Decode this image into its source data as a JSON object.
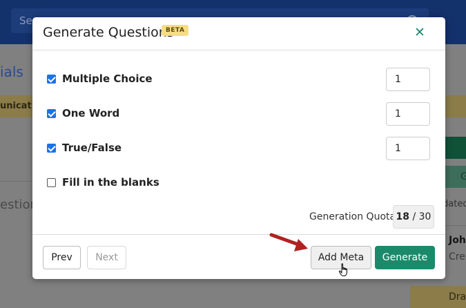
{
  "background": {
    "search_placeholder": "Sea",
    "heading_fragment": "ials",
    "badge_fragment": "unicat",
    "questions_fragment": "estion",
    "green_btn_fragment": "G",
    "updated_fragment": "dated",
    "card_name_fragment": "John",
    "card_sub_fragment": "Crea",
    "draft_fragment": "Dra"
  },
  "modal": {
    "title": "Generate Questions",
    "beta_label": "BETA",
    "options": [
      {
        "label": "Multiple Choice",
        "checked": true,
        "count": "1"
      },
      {
        "label": "One Word",
        "checked": true,
        "count": "1"
      },
      {
        "label": "True/False",
        "checked": true,
        "count": "1"
      },
      {
        "label": "Fill in the blanks",
        "checked": false
      }
    ],
    "quota": {
      "label": "Generation Quota",
      "used": "18",
      "separator": "/",
      "total": "30"
    },
    "footer": {
      "prev_label": "Prev",
      "next_label": "Next",
      "add_meta_label": "Add Meta",
      "generate_label": "Generate"
    }
  },
  "colors": {
    "accent_green": "#1b8a6b",
    "checkbox_blue": "#1a73e8",
    "beta_yellow": "#f6dc83",
    "arrow_red": "#b02222"
  }
}
